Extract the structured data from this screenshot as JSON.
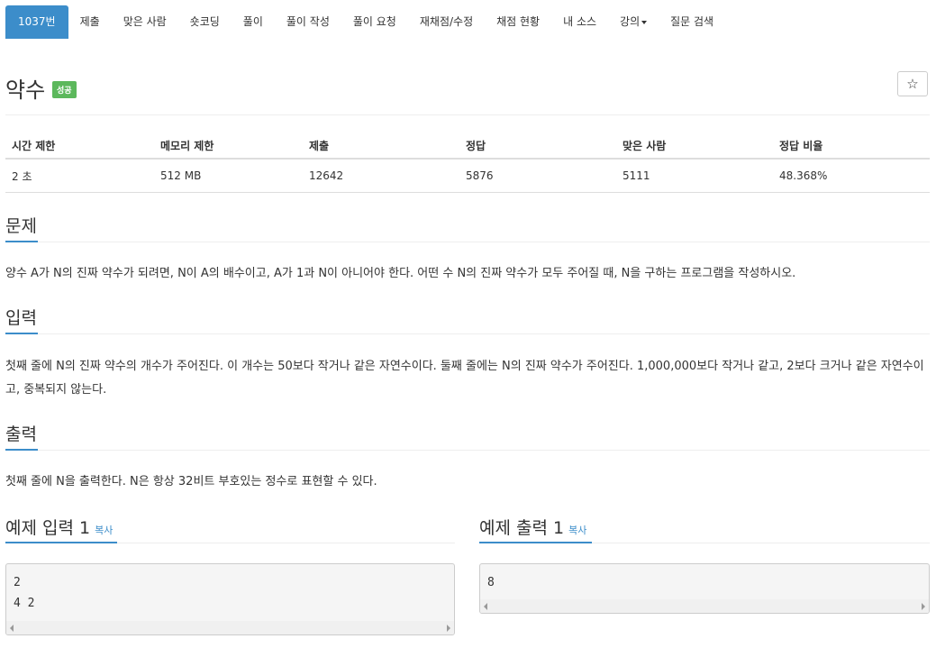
{
  "nav": {
    "tabs": [
      {
        "label": "1037번",
        "active": true
      },
      {
        "label": "제출"
      },
      {
        "label": "맞은 사람"
      },
      {
        "label": "숏코딩"
      },
      {
        "label": "풀이"
      },
      {
        "label": "풀이 작성"
      },
      {
        "label": "풀이 요청"
      },
      {
        "label": "재채점/수정"
      },
      {
        "label": "채점 현황"
      },
      {
        "label": "내 소스"
      },
      {
        "label": "강의"
      },
      {
        "label": "질문 검색"
      }
    ]
  },
  "problem": {
    "title": "약수",
    "badge": "성공",
    "star": "☆"
  },
  "stats": {
    "headers": [
      "시간 제한",
      "메모리 제한",
      "제출",
      "정답",
      "맞은 사람",
      "정답 비율"
    ],
    "values": [
      "2 초",
      "512 MB",
      "12642",
      "5876",
      "5111",
      "48.368%"
    ]
  },
  "sections": {
    "problem_heading": "문제",
    "problem_text": "양수 A가 N의 진짜 약수가 되려면, N이 A의 배수이고, A가 1과 N이 아니어야 한다. 어떤 수 N의 진짜 약수가 모두 주어질 때, N을 구하는 프로그램을 작성하시오.",
    "input_heading": "입력",
    "input_text": "첫째 줄에 N의 진짜 약수의 개수가 주어진다. 이 개수는 50보다 작거나 같은 자연수이다. 둘째 줄에는 N의 진짜 약수가 주어진다. 1,000,000보다 작거나 같고, 2보다 크거나 같은 자연수이고, 중복되지 않는다.",
    "output_heading": "출력",
    "output_text": "첫째 줄에 N을 출력한다. N은 항상 32비트 부호있는 정수로 표현할 수 있다."
  },
  "samples": {
    "input_heading": "예제 입력 1",
    "output_heading": "예제 출력 1",
    "copy_label": "복사",
    "input_lines": "2\n4 2",
    "output_lines": "8"
  },
  "colors": {
    "accent": "#3c8dca",
    "success": "#5cb85c"
  }
}
